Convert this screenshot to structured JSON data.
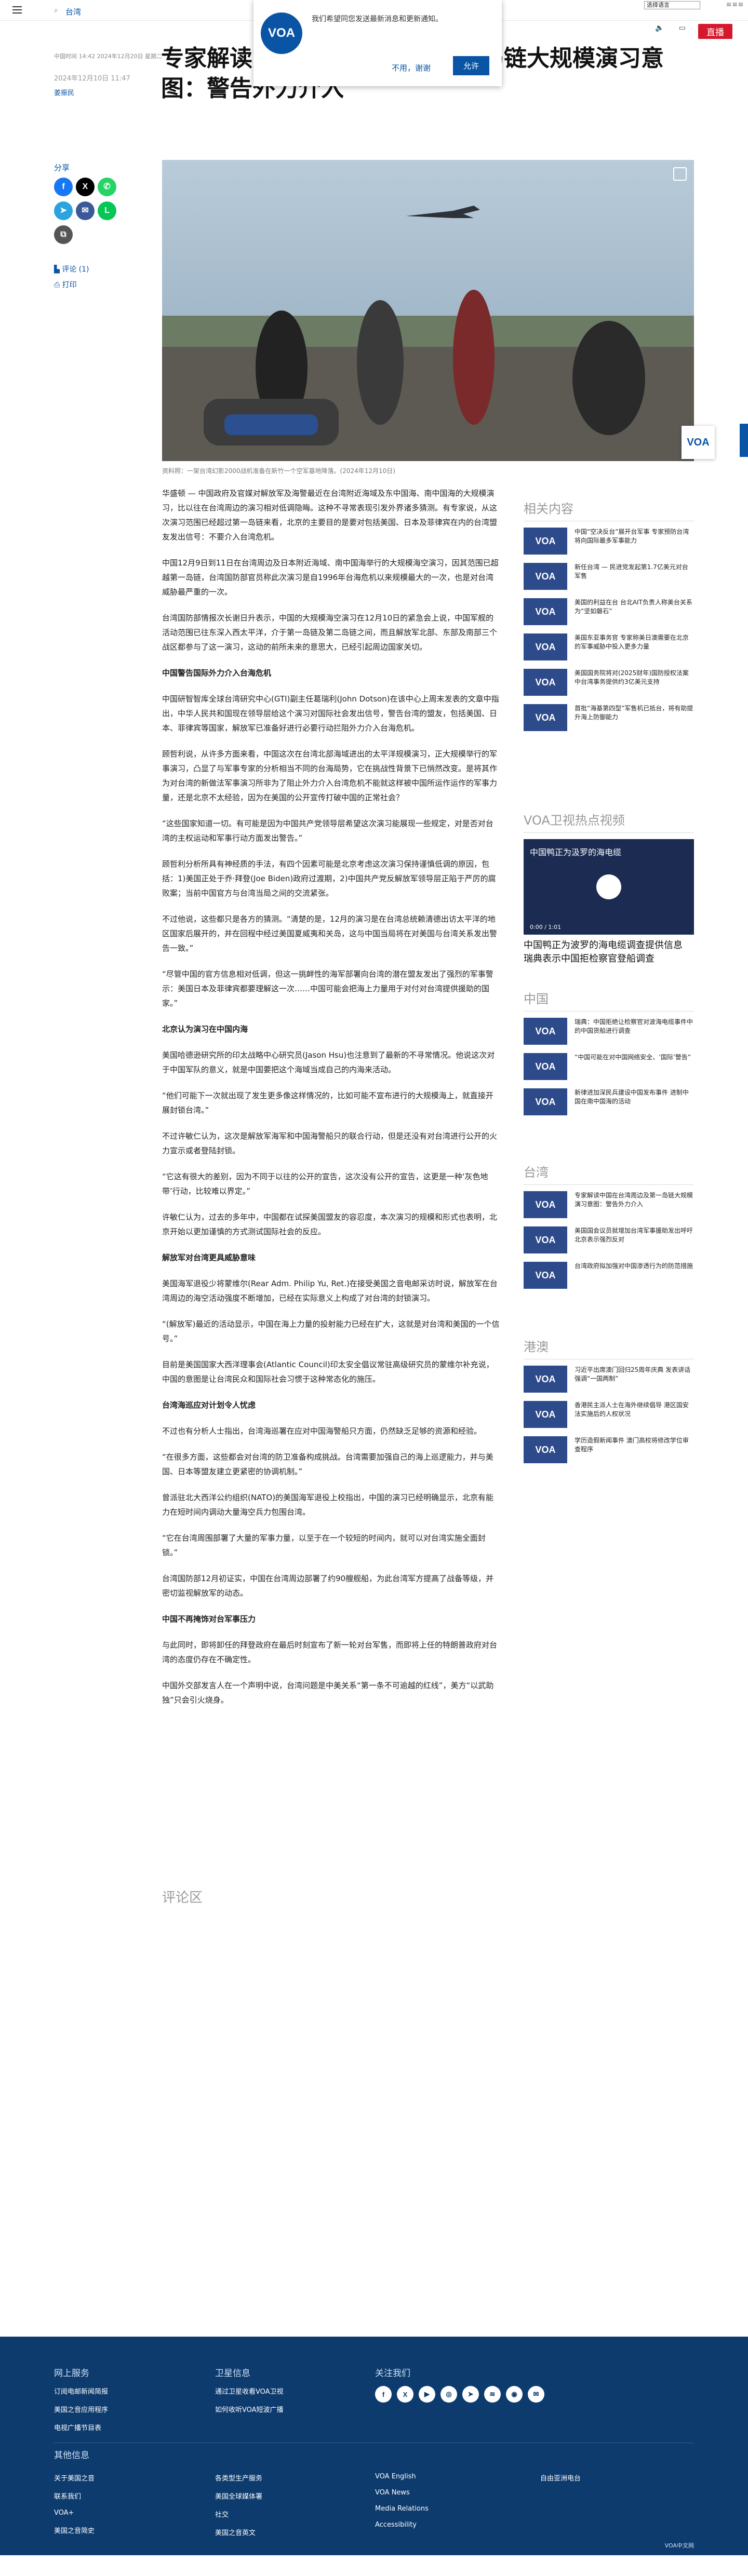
{
  "header": {
    "site_name": "台湾",
    "lang_select": "选择语言",
    "live_label": "直播"
  },
  "notify": {
    "logo": "VOA",
    "message": "我们希望同您发送最新消息和更新通知。",
    "deny": "不用，谢谢",
    "allow": "允许"
  },
  "article": {
    "meta": "中国时间 14:42 2024年12月20日 星期二",
    "title": "专家解读中国在台湾周边及第一岛链大规模演习意图：警告外力介入",
    "date": "2024年12月10日 11:47",
    "author": "姜振民",
    "share_label": "分享",
    "comments_link": "评论 (1)",
    "print_link": "打印",
    "image_caption": "资料照：一架台湾幻影2000战机准备在新竹一个空军基地降落。(2024年12月10日)",
    "paragraphs": [
      "华盛顿 — 中国政府及官媒对解放军及海警最近在台湾附近海域及东中国海、南中国海的大规模演习，比以往在台湾周边的演习相对低调隐晦。这种不寻常表现引发外界诸多猜测。有专家说，从这次演习范围已经超过第一岛链来看，北京的主要目的是要对包括美国、日本及菲律宾在内的台湾盟友发出信号：不要介入台湾危机。",
      "中国12月9日到11日在台湾周边及日本附近海域、南中国海举行的大规模海空演习，因其范围已超越第一岛链，台湾国防部官员称此次演习是自1996年台海危机以来规模最大的一次，也是对台湾威胁最严重的一次。",
      "台湾国防部情报次长谢日升表示，中国的大规模海空演习在12月10日的紧急会上说，中国军舰的活动范围已往东深入西太平洋，介于第一岛链及第二岛链之间，而且解放军北部、东部及南部三个战区都参与了这一演习，这动的前所未来的意思大，已经引起周边国家关切。"
    ],
    "sections": [
      {
        "heading": "中国警告国际外力介入台海危机",
        "paragraphs": [
          "中国研智智库全球台湾研究中心(GTI)副主任葛瑞利(John Dotson)在该中心上周末发表的文章中指出，中华人民共和国现在领导层给这个演习对国际社会发出信号，警告台湾的盟友，包括美国、日本、菲律宾等国家，解放军已准备好进行必要行动拦阻外力介入台海危机。",
          "顾哲利说，从许多方面来看，中国这次在台湾北部海域进出的太平洋规模演习，正大规模举行的军事演习，凸显了与军事专家的分析相当不同的台海局势，它在挑战性背景下已悄然改变。是将其作为对台湾的新做法军事演习所非为了阻止外力介入台湾危机不能就这样被中国所运作运作的军事力量，还是北京不太经验，因为在美国的公开宣传打破中国的正常社会？",
          "“这些国家知道一切。有可能是因为中国共产党领导层希望这次演习能展现一些规定，对是否对台湾的主权运动和军事行动方面发出警告。”",
          "顾哲利分析所具有神经质的手法，有四个因素可能是北京考虑这次演习保持谨慎低调的原因，包括：1)美国正处于乔·拜登(Joe Biden)政府过渡期，2)中国共产党反解放军领导层正陷于严厉的腐败案；当前中国官方与台湾当局之间的交流紧张。"
        ]
      }
    ],
    "more_paragraphs": [
      "不过他说，这些都只是各方的猜测。“清楚的是，12月的演习是在台湾总统赖清德出访太平洋的地区国家后展开的，并在回程中经过美国夏威夷和关岛，这与中国当局将在对美国与台湾关系发出警告一致。”",
      "“尽管中国的官方信息相对低调，但这一挑衅性的海军部署向台湾的潜在盟友发出了强烈的军事警示：美国日本及菲律宾都要理解这一次……中国可能会把海上力量用于对付对台湾提供援助的国家。”"
    ],
    "sections2": [
      {
        "heading": "北京认为演习在中国内海",
        "paragraphs": [
          "美国哈德逊研究所的印太战略中心研究员(Jason Hsu)也注意到了最新的不寻常情况。他说这次对于中国军队的意义，就是中国要把这个海域当成自己的内海来活动。",
          "“他们可能下一次就出现了发生更多像这样情况的，比如可能不宣布进行的大规模海上，就直接开展封锁台湾。”",
          "不过许敏仁认为，这次是解放军海军和中国海警船只的联合行动，但是还没有对台湾进行公开的火力宣示或者登陆封锁。",
          "“它这有很大的差别，因为不同于以往的公开的宣告，这次没有公开的宣告，这更是一种‘灰色地带’行动，比较难以界定。”",
          "许敏仁认为，过去的多年中，中国都在试探美国盟友的容忍度，本次演习的规模和形式也表明，北京开始以更加谨慎的方式测试国际社会的反应。"
        ]
      },
      {
        "heading": "解放军对台湾更具威胁意味",
        "paragraphs": [
          "美国海军退役少将蒙维尔(Rear Adm. Philip Yu, Ret.)在接受美国之音电邮采访时说，解放军在台湾周边的海空活动强度不断增加，已经在实际意义上构成了对台湾的封锁演习。",
          "“(解放军)最近的活动显示，中国在海上力量的投射能力已经在扩大，这就是对台湾和美国的一个信号。”",
          "目前是美国国家大西洋理事会(Atlantic Council)印太安全倡议常驻高级研究员的蒙维尔补充说，中国的意图是让台湾民众和国际社会习惯于这种常态化的施压。"
        ]
      },
      {
        "heading": "台湾海巡应对计划令人忧虑",
        "paragraphs": [
          "不过也有分析人士指出，台湾海巡署在应对中国海警船只方面，仍然缺乏足够的资源和经验。",
          "“在很多方面，这些都会对台湾的防卫准备构成挑战。台湾需要加强自己的海上巡逻能力，并与美国、日本等盟友建立更紧密的协调机制。”",
          "曾派驻北大西洋公约组织(NATO)的美国海军退役上校指出，中国的演习已经明确显示，北京有能力在短时间内调动大量海空兵力包围台湾。",
          "“它在台湾周围部署了大量的军事力量，以至于在一个较短的时间内，就可以对台湾实施全面封锁。”",
          "台湾国防部12月初证实，中国在台湾周边部署了约90艘舰船，为此台湾军方提高了战备等级，并密切监视解放军的动态。"
        ]
      },
      {
        "heading": "中国不再掩饰对台军事压力",
        "paragraphs": [
          "与此同时，即将卸任的拜登政府在最后时刻宣布了新一轮对台军售，而即将上任的特朗普政府对台湾的态度仍存在不确定性。",
          "中国外交部发言人在一个声明中说，台湾问题是中美关系“第一条不可逾越的红线”，美方“以武助独”只会引火烧身。"
        ]
      }
    ],
    "comments_heading": "评论区"
  },
  "sidebar": {
    "related_title": "相关内容",
    "related": [
      "中国“空决反台”展开台军事 专家预防台湾将向国际最多军事能力",
      "新任台湾 — 民进党发起第1.7亿美元对台军售",
      "美国的利益在台 台北AIT负责人称美台关系为“坚如磐石”",
      "美国东亚事务官 专家称美日澳需要在北京的军事威胁中投入更多力量",
      "美国国务院将对(2025财年)国防授权法案中台湾事务提供约3亿美元支持",
      "首批“海基第四型”军售机已抵台，将有助提升海上防御能力"
    ],
    "video_title": "VOA卫视热点视频",
    "video_overlay": "中国鸭正为汲罗的海电缆",
    "video_time": "0:00 / 1:01",
    "video_caption": "中国鸭正为波罗的海电缆调查提供信息 瑞典表示中国拒检察官登船调查",
    "china_title": "中国",
    "china": [
      "瑞典：中国拒绝让检察官对波海电缆事件中的中国货船进行调查",
      "“中国可能在对中国网络安全、‘国际’警告”",
      "新律进加深民兵建设中国发布事件 进制中国在南中国海的活动"
    ],
    "taiwan_title": "台湾",
    "taiwan": [
      "专家解读中国在台湾周边及第一岛链大规模演习意图：警告外力介入",
      "美国国会议员就增加台湾军事援助发出呼吁 北京表示强烈反对",
      "台湾政府拟加强对中国渗透行为的防范措施"
    ],
    "hk_title": "港澳",
    "hk": [
      "习近平出席澳门回归25周年庆典 发表讲话强调“一国两制”",
      "香港民主派人士在海外继续倡导 港区国安法实施后的人权状况",
      "学历造假新闻事件 澳门高校将修改学位审查程序"
    ]
  },
  "footer": {
    "col1_title": "网上服务",
    "col1": [
      "订阅电邮新闻简报",
      "美国之音应用程序",
      "电视广播节目表"
    ],
    "col2_title": "卫星信息",
    "col2": [
      "通过卫星收看VOA卫视",
      "如何收听VOA短波广播"
    ],
    "col3_title": "关注我们",
    "other_title": "其他信息",
    "other_col1": [
      "关于美国之音",
      "联系我们",
      "VOA+",
      "美国之音简史"
    ],
    "other_col2": [
      "各类型生产服务",
      "美国全球媒体署",
      "社交",
      "美国之音英文"
    ],
    "other_col3": [
      "VOA English",
      "VOA News",
      "Media Relations",
      "Accessibility"
    ],
    "other_col4": [
      "自由亚洲电台"
    ],
    "copyright": "VOA中文网"
  }
}
